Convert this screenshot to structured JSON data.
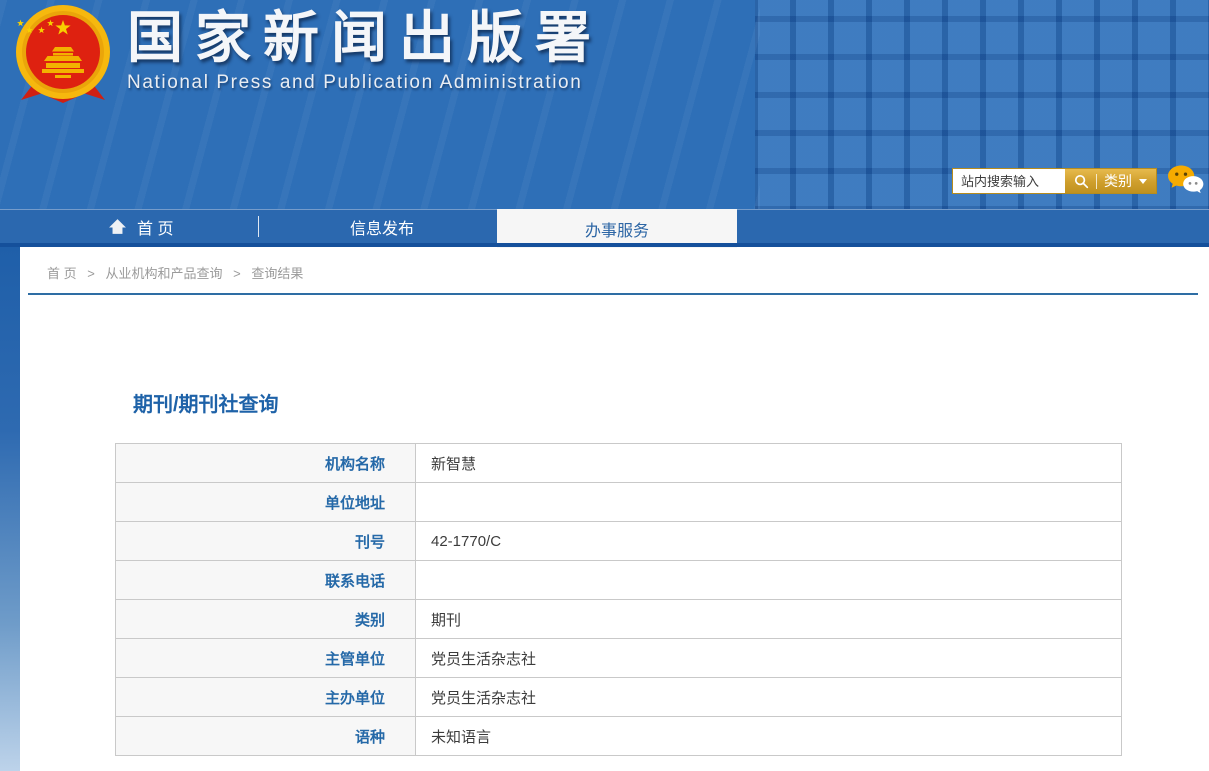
{
  "header": {
    "title": "国家新闻出版署",
    "subtitle": "National Press and Publication Administration",
    "search": {
      "placeholder": "站内搜索输入",
      "category_label": "类别"
    }
  },
  "nav": {
    "items": [
      {
        "label": "首 页",
        "active": false
      },
      {
        "label": "信息发布",
        "active": false
      },
      {
        "label": "办事服务",
        "active": true
      }
    ]
  },
  "breadcrumb": {
    "items": [
      "首 页",
      "从业机构和产品查询",
      "查询结果"
    ],
    "separator": ">"
  },
  "main": {
    "title": "期刊/期刊社查询",
    "table": {
      "rows": [
        {
          "label": "机构名称",
          "value": "新智慧"
        },
        {
          "label": "单位地址",
          "value": ""
        },
        {
          "label": "刊号",
          "value": "42-1770/C"
        },
        {
          "label": "联系电话",
          "value": ""
        },
        {
          "label": "类别",
          "value": "期刊"
        },
        {
          "label": "主管单位",
          "value": "党员生活杂志社"
        },
        {
          "label": "主办单位",
          "value": "党员生活杂志社"
        },
        {
          "label": "语种",
          "value": "未知语言"
        }
      ]
    }
  },
  "icons": {
    "logo": "national-emblem",
    "home": "home-icon",
    "search": "magnifier-icon",
    "caret": "caret-down-icon",
    "wechat": "wechat-icon"
  },
  "colors": {
    "header_blue": "#2e6fb7",
    "nav_blue": "#2b68af",
    "nav_dark_blue": "#15509b",
    "gold": "#cf9f2c",
    "title_blue": "#1e62a8",
    "label_blue": "#2569a8",
    "breadcrumb_gray": "#9a9a9a",
    "table_border": "#c9c9c9",
    "label_bg": "#f7f7f7",
    "rule_blue": "#2e6da4"
  }
}
